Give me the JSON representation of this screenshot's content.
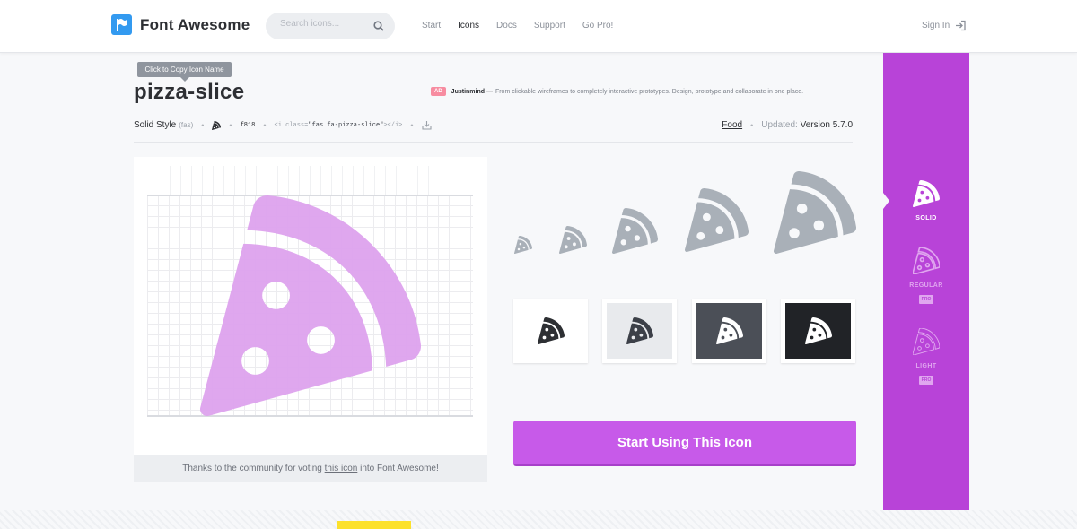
{
  "header": {
    "brand": "Font Awesome",
    "search_placeholder": "Search icons...",
    "nav": [
      "Start",
      "Icons",
      "Docs",
      "Support",
      "Go Pro!"
    ],
    "active_nav": "Icons",
    "sign_in": "Sign In"
  },
  "icon": {
    "tooltip": "Click to Copy Icon Name",
    "name": "pizza-slice",
    "style_label": "Solid Style",
    "style_prefix": "(fas)",
    "unicode": "f818",
    "snippet_open": "<i class=",
    "snippet_class": "\"fas fa-pizza-slice\"",
    "snippet_close": "></i>",
    "category": "Food",
    "updated_label": "Updated:",
    "version": "Version 5.7.0"
  },
  "ad": {
    "badge": "AD",
    "sponsor": "Justinmind —",
    "text": "From clickable wireframes to completely interactive prototypes. Design, prototype and collaborate in one place."
  },
  "preview": {
    "thanks_pre": "Thanks to the community for voting",
    "thanks_link": "this icon",
    "thanks_post": "into Font Awesome!"
  },
  "cta_label": "Start Using This Icon",
  "styles": [
    {
      "label": "SOLID",
      "badge": ""
    },
    {
      "label": "REGULAR",
      "badge": "PRO"
    },
    {
      "label": "LIGHT",
      "badge": "PRO"
    }
  ],
  "colors": {
    "accent": "#b843d8",
    "cta": "#c75ae9",
    "preview_icon": "#dea3ee",
    "scale_icon": "#a9b0b8",
    "brand_blue": "#339af0"
  },
  "icons": {
    "brand": "flag-icon",
    "search": "search-icon",
    "sign_in": "sign-in-icon",
    "glyph": "pizza-slice-icon",
    "download": "download-icon"
  }
}
